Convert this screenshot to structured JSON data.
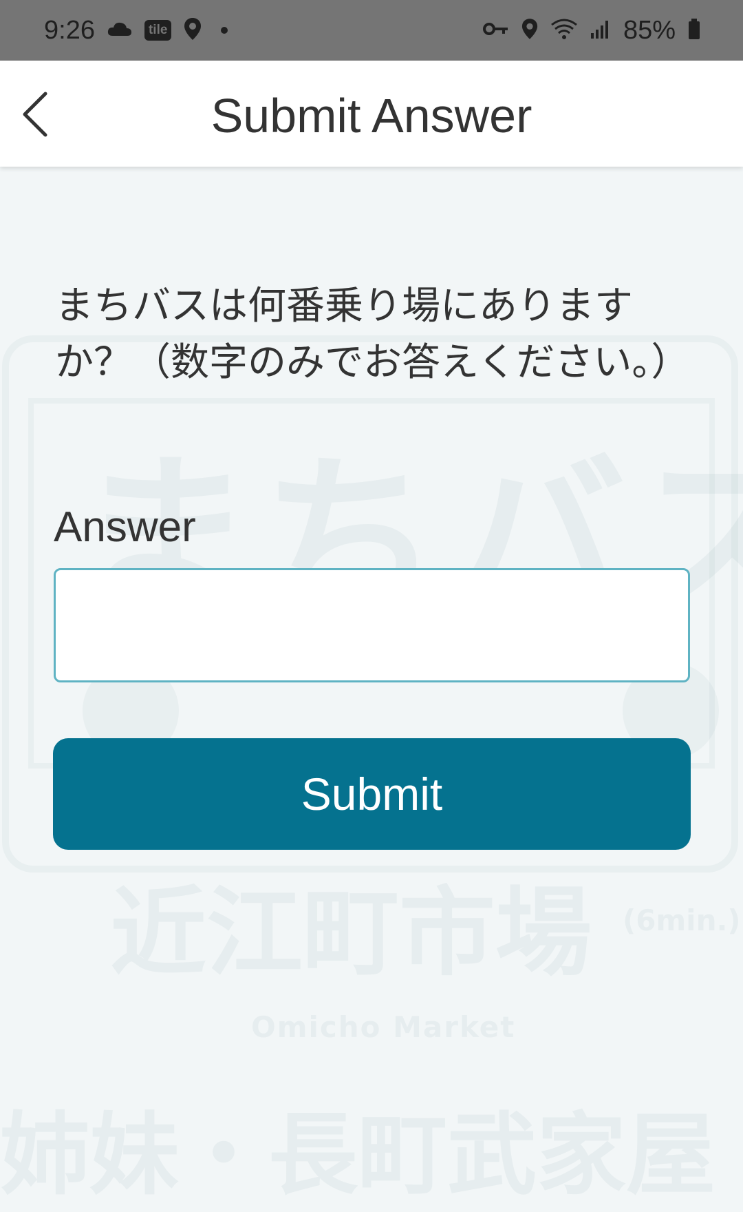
{
  "status_bar": {
    "time": "9:26",
    "tile_badge": "tile",
    "battery": "85%"
  },
  "header": {
    "title": "Submit Answer"
  },
  "question": {
    "text": "まちバスは何番乗り場にありますか？（数字のみでお答えください。）"
  },
  "form": {
    "answer_label": "Answer",
    "answer_value": "",
    "submit_label": "Submit"
  },
  "background": {
    "logo_text": "まちバス",
    "destination_jp": "近江町市場",
    "destination_time": "(6min.)",
    "destination_en": "Omicho Market",
    "bottom_text": "姉妹・長町武家屋"
  },
  "colors": {
    "accent": "#05728f",
    "input_border": "#5fb3c3",
    "status_bar": "#757575"
  }
}
